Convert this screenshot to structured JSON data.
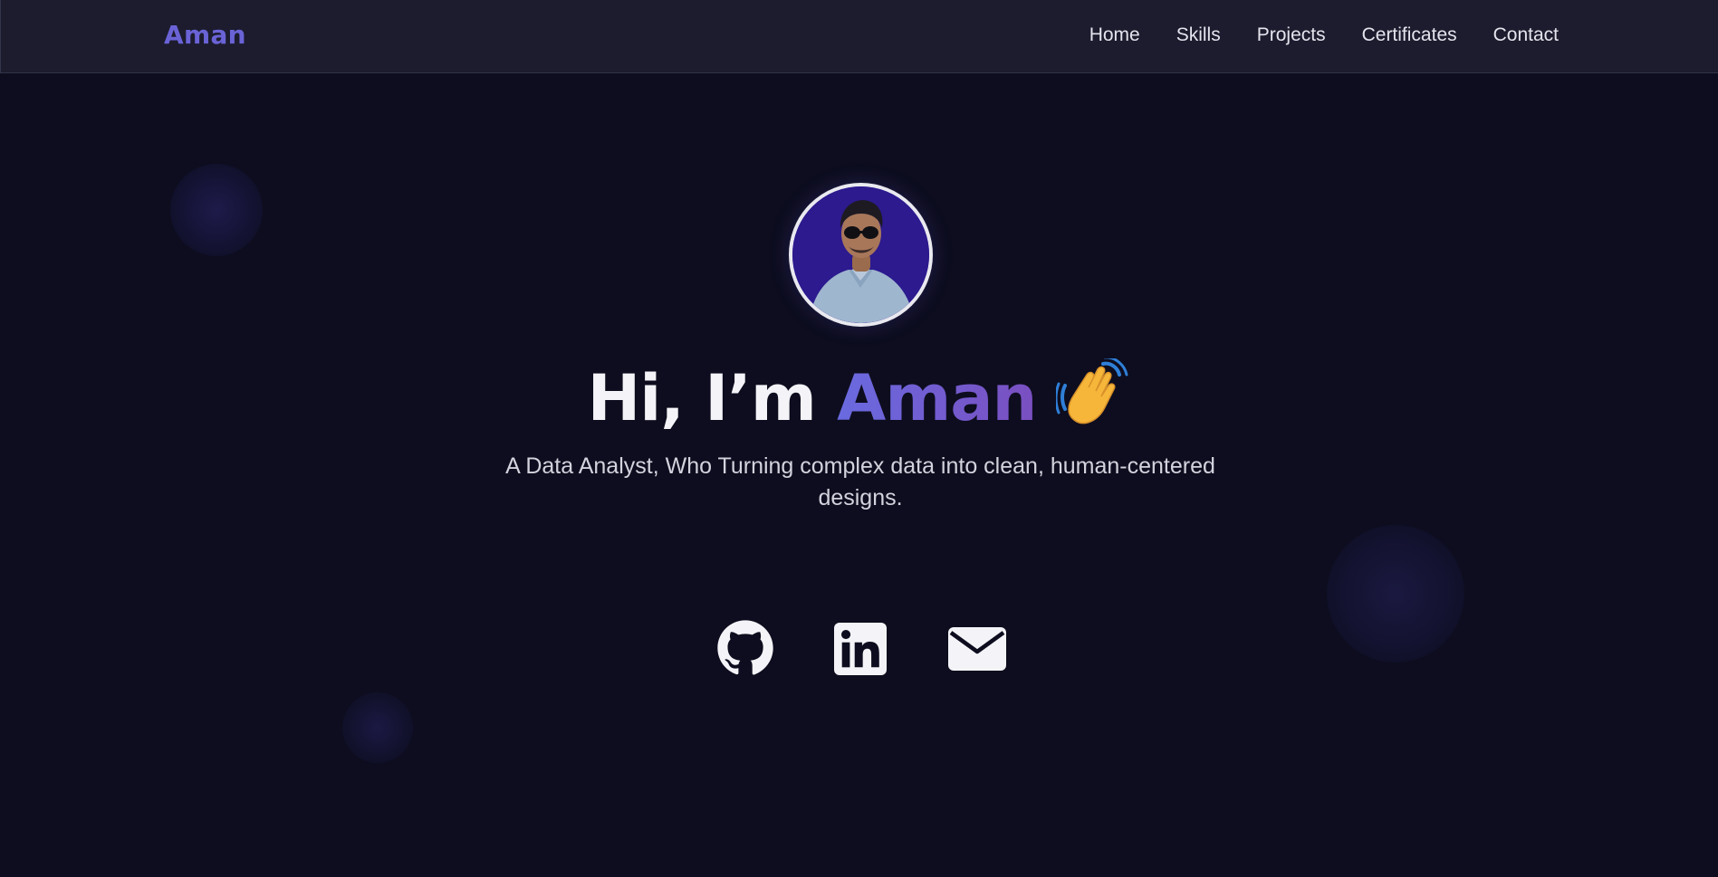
{
  "nav": {
    "brand": "Aman",
    "links": [
      "Home",
      "Skills",
      "Projects",
      "Certificates",
      "Contact"
    ]
  },
  "hero": {
    "greeting": "Hi, I’m ",
    "name": "Aman",
    "emoji_icon": "waving-hand-icon",
    "subtitle": "A Data Analyst, Who Turning complex data into clean, human-centered designs."
  },
  "socials": [
    {
      "icon": "github-icon"
    },
    {
      "icon": "linkedin-icon"
    },
    {
      "icon": "mail-icon"
    }
  ],
  "colors": {
    "background": "#0d0d1f",
    "navbar": "#1c1c2e",
    "accent_start": "#6a6ae0",
    "accent_end": "#7a4fc0",
    "avatar_bg": "#2c1a8e"
  }
}
